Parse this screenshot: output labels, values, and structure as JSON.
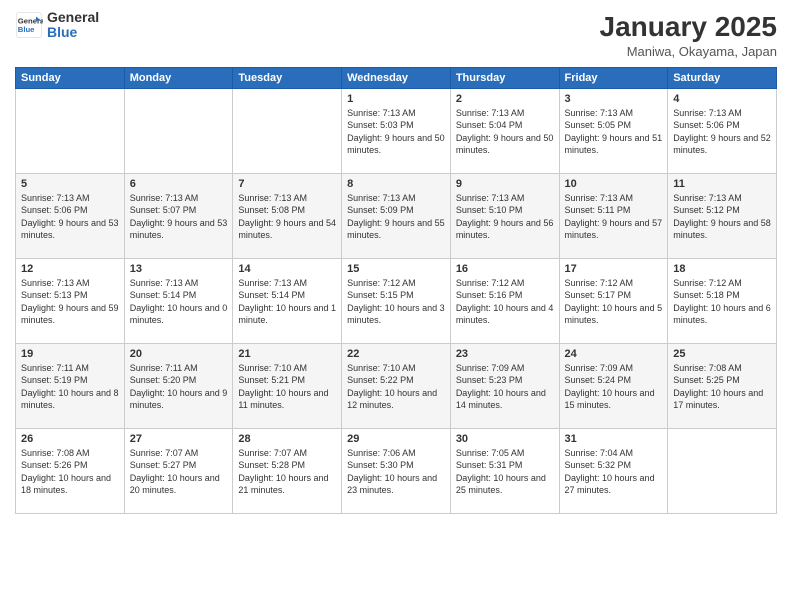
{
  "logo": {
    "line1": "General",
    "line2": "Blue"
  },
  "title": "January 2025",
  "subtitle": "Maniwa, Okayama, Japan",
  "weekdays": [
    "Sunday",
    "Monday",
    "Tuesday",
    "Wednesday",
    "Thursday",
    "Friday",
    "Saturday"
  ],
  "weeks": [
    [
      {
        "day": "",
        "text": ""
      },
      {
        "day": "",
        "text": ""
      },
      {
        "day": "",
        "text": ""
      },
      {
        "day": "1",
        "text": "Sunrise: 7:13 AM\nSunset: 5:03 PM\nDaylight: 9 hours and 50 minutes."
      },
      {
        "day": "2",
        "text": "Sunrise: 7:13 AM\nSunset: 5:04 PM\nDaylight: 9 hours and 50 minutes."
      },
      {
        "day": "3",
        "text": "Sunrise: 7:13 AM\nSunset: 5:05 PM\nDaylight: 9 hours and 51 minutes."
      },
      {
        "day": "4",
        "text": "Sunrise: 7:13 AM\nSunset: 5:06 PM\nDaylight: 9 hours and 52 minutes."
      }
    ],
    [
      {
        "day": "5",
        "text": "Sunrise: 7:13 AM\nSunset: 5:06 PM\nDaylight: 9 hours and 53 minutes."
      },
      {
        "day": "6",
        "text": "Sunrise: 7:13 AM\nSunset: 5:07 PM\nDaylight: 9 hours and 53 minutes."
      },
      {
        "day": "7",
        "text": "Sunrise: 7:13 AM\nSunset: 5:08 PM\nDaylight: 9 hours and 54 minutes."
      },
      {
        "day": "8",
        "text": "Sunrise: 7:13 AM\nSunset: 5:09 PM\nDaylight: 9 hours and 55 minutes."
      },
      {
        "day": "9",
        "text": "Sunrise: 7:13 AM\nSunset: 5:10 PM\nDaylight: 9 hours and 56 minutes."
      },
      {
        "day": "10",
        "text": "Sunrise: 7:13 AM\nSunset: 5:11 PM\nDaylight: 9 hours and 57 minutes."
      },
      {
        "day": "11",
        "text": "Sunrise: 7:13 AM\nSunset: 5:12 PM\nDaylight: 9 hours and 58 minutes."
      }
    ],
    [
      {
        "day": "12",
        "text": "Sunrise: 7:13 AM\nSunset: 5:13 PM\nDaylight: 9 hours and 59 minutes."
      },
      {
        "day": "13",
        "text": "Sunrise: 7:13 AM\nSunset: 5:14 PM\nDaylight: 10 hours and 0 minutes."
      },
      {
        "day": "14",
        "text": "Sunrise: 7:13 AM\nSunset: 5:14 PM\nDaylight: 10 hours and 1 minute."
      },
      {
        "day": "15",
        "text": "Sunrise: 7:12 AM\nSunset: 5:15 PM\nDaylight: 10 hours and 3 minutes."
      },
      {
        "day": "16",
        "text": "Sunrise: 7:12 AM\nSunset: 5:16 PM\nDaylight: 10 hours and 4 minutes."
      },
      {
        "day": "17",
        "text": "Sunrise: 7:12 AM\nSunset: 5:17 PM\nDaylight: 10 hours and 5 minutes."
      },
      {
        "day": "18",
        "text": "Sunrise: 7:12 AM\nSunset: 5:18 PM\nDaylight: 10 hours and 6 minutes."
      }
    ],
    [
      {
        "day": "19",
        "text": "Sunrise: 7:11 AM\nSunset: 5:19 PM\nDaylight: 10 hours and 8 minutes."
      },
      {
        "day": "20",
        "text": "Sunrise: 7:11 AM\nSunset: 5:20 PM\nDaylight: 10 hours and 9 minutes."
      },
      {
        "day": "21",
        "text": "Sunrise: 7:10 AM\nSunset: 5:21 PM\nDaylight: 10 hours and 11 minutes."
      },
      {
        "day": "22",
        "text": "Sunrise: 7:10 AM\nSunset: 5:22 PM\nDaylight: 10 hours and 12 minutes."
      },
      {
        "day": "23",
        "text": "Sunrise: 7:09 AM\nSunset: 5:23 PM\nDaylight: 10 hours and 14 minutes."
      },
      {
        "day": "24",
        "text": "Sunrise: 7:09 AM\nSunset: 5:24 PM\nDaylight: 10 hours and 15 minutes."
      },
      {
        "day": "25",
        "text": "Sunrise: 7:08 AM\nSunset: 5:25 PM\nDaylight: 10 hours and 17 minutes."
      }
    ],
    [
      {
        "day": "26",
        "text": "Sunrise: 7:08 AM\nSunset: 5:26 PM\nDaylight: 10 hours and 18 minutes."
      },
      {
        "day": "27",
        "text": "Sunrise: 7:07 AM\nSunset: 5:27 PM\nDaylight: 10 hours and 20 minutes."
      },
      {
        "day": "28",
        "text": "Sunrise: 7:07 AM\nSunset: 5:28 PM\nDaylight: 10 hours and 21 minutes."
      },
      {
        "day": "29",
        "text": "Sunrise: 7:06 AM\nSunset: 5:30 PM\nDaylight: 10 hours and 23 minutes."
      },
      {
        "day": "30",
        "text": "Sunrise: 7:05 AM\nSunset: 5:31 PM\nDaylight: 10 hours and 25 minutes."
      },
      {
        "day": "31",
        "text": "Sunrise: 7:04 AM\nSunset: 5:32 PM\nDaylight: 10 hours and 27 minutes."
      },
      {
        "day": "",
        "text": ""
      }
    ]
  ]
}
